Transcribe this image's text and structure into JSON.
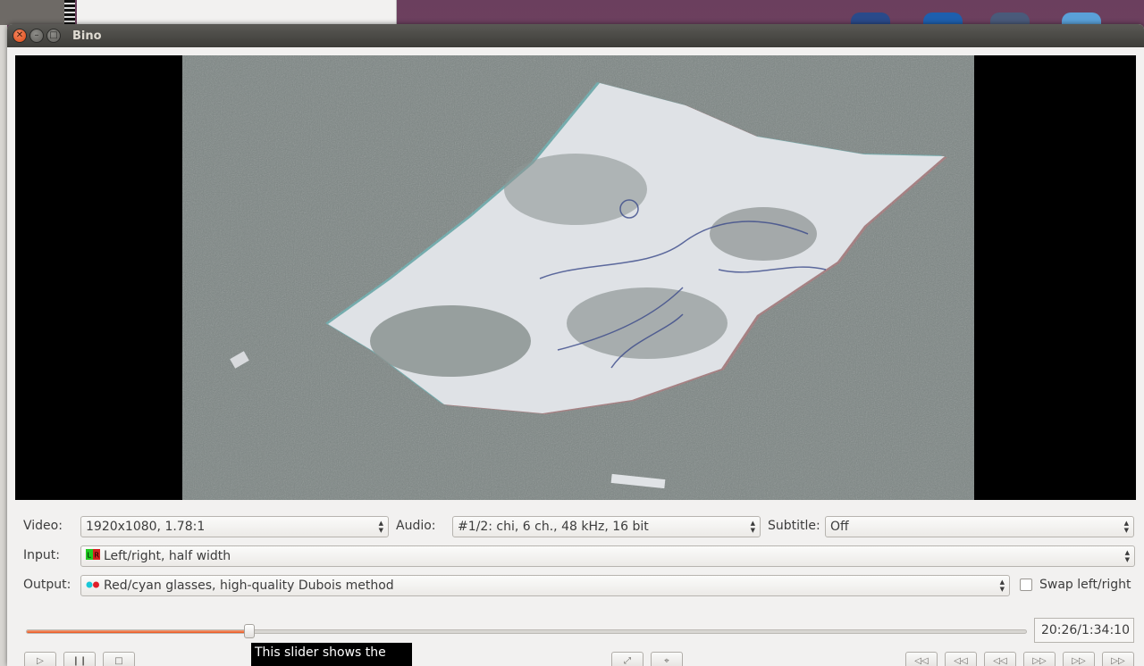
{
  "window": {
    "title": "Bino"
  },
  "video_row": {
    "video_label": "Video:",
    "video_value": "1920x1080, 1.78:1",
    "audio_label": "Audio:",
    "audio_value": "#1/2: chi, 6 ch., 48 kHz, 16 bit",
    "subtitle_label": "Subtitle:",
    "subtitle_value": "Off"
  },
  "input_row": {
    "label": "Input:",
    "value": "Left/right, half width"
  },
  "output_row": {
    "label": "Output:",
    "value": "Red/cyan glasses, high-quality Dubois method",
    "swap_label": "Swap left/right",
    "swap_checked": false
  },
  "seek": {
    "position_fraction": 0.223,
    "time_text": "20:26/1:34:10"
  },
  "tooltip": {
    "line1": "This slider shows the"
  },
  "colors": {
    "accent": "#e9541c",
    "close_button": "#df4b16",
    "titlebar": "#3d3c38"
  },
  "icons": {
    "play": "play-icon",
    "pause": "pause-icon",
    "stop": "stop-icon",
    "fullscreen": "fullscreen-icon",
    "center": "center-icon",
    "seek_back_10min": "rewind-icon",
    "seek_back_1min": "rewind-icon",
    "seek_back_10s": "rewind-icon",
    "seek_fwd_10s": "fast-forward-icon",
    "seek_fwd_1min": "fast-forward-icon",
    "seek_fwd_10min": "fast-forward-icon"
  }
}
